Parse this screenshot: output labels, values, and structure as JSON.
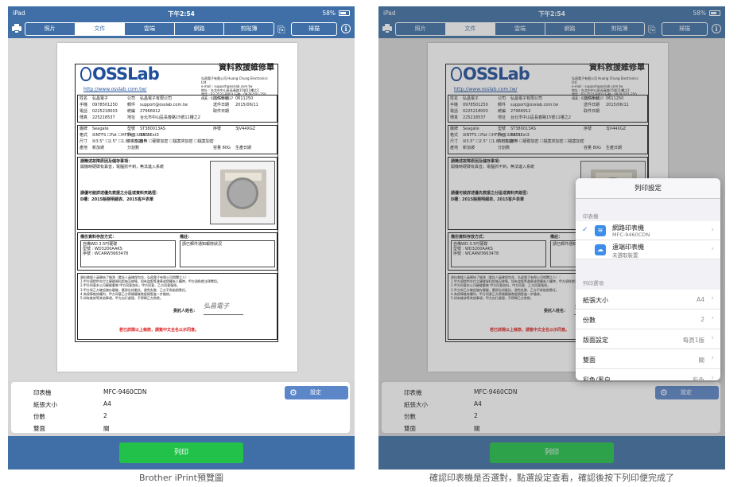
{
  "status": {
    "carrier": "iPad",
    "time": "下午2:54",
    "battery": "58%"
  },
  "toolbar": {
    "tabs": [
      "照片",
      "文件",
      "雲端",
      "網路",
      "剪貼簿"
    ],
    "active_tab": "文件",
    "edit_label": "掃描"
  },
  "form": {
    "logo": "OSSLab",
    "url": "http://www.osslab.com.tw/",
    "title": "資料救援維修單",
    "company": [
      "弘昌電子有限公司 Huang Chung Electronics Ltd.",
      "e-mail : support@osslab.com.tw",
      "地址 : 台北市中山區長春路15號11樓之2",
      "電話 : 02-2521-8003   行動 : 0978-501-250",
      "傳真 : 02-2521-8537"
    ],
    "rows1": [
      [
        "姓名",
        "弘昌電子",
        "公司",
        "弘昌電子有限公司",
        "送件單號",
        "0611250"
      ],
      [
        "手機",
        "0978501250",
        "郵件",
        "support@osslab.com.tw",
        "送件日期",
        "2015/06/11"
      ],
      [
        "電話",
        "0225218003",
        "統編",
        "27966912",
        "取件日期",
        ""
      ],
      [
        "傳真",
        "225218537",
        "地址",
        "台北市中山區長春路15號11樓之2",
        "",
        ""
      ]
    ],
    "rows2": [
      [
        "廠牌",
        "Seagate",
        "型號",
        "ST380013AS",
        "序號",
        "3JV44XGZ"
      ],
      [
        "格式",
        "☒NTFS ☐Fat ☐HFS+ ☐UFS ☐Ext3",
        "界面",
        "SATA",
        "",
        ""
      ],
      [
        "尺寸",
        "☒3.5\" ☐2.5\" ☐1.8\" ☐5.25\"",
        "資料加密",
        "☒無 ☐硬碟加密 ☐檔案夾加密 ☐檔案加密",
        "",
        ""
      ],
      [
        "產地",
        "新加坡",
        "分割數",
        "",
        "容量 80G",
        "生產日期"
      ]
    ],
    "issue_label": "請簡述故障原因及儲存事項：",
    "issue_text": "開機時硬碟有異音，電腦抓不到，無法進入系統",
    "path_label": "請優可敍詳述優先救援之分區或資料夾路徑：",
    "path_text": "D槽：2015賬務明細表、2015客戶表單",
    "backup_label": "備份資料存放方式：",
    "backup_lines": [
      "自備WD 3.5吋硬碟",
      "型號 : WD3200AAKS",
      "序號 : WCARW3663478"
    ],
    "note_label": "備註：",
    "note_text": "請已郵件通知報修狀況",
    "terms": [
      "資料救援人員開始了檢測（委託人員確保包含，弘昌電子有限公司相關之人）：",
      "1.甲方須提供交付之硬碟資料設施沒故障，如有盜版等違章或侵權有人權時，甲方須負擔法律費用。",
      "2.甲方同意本公司硬碟重做 甲方同意加料，甲方同意、乙方同意復原。",
      "3.甲方與乙方確認儲存硬碟，應即告知委託，避免失敗、乙方不負賠償責任。",
      "4.為保障維修權利，甲方同意乙方將開硬碟救援損害進一步檢修。",
      "5.如有維修等其他事項，甲方自行處理，不得歸乙方負擔。"
    ],
    "footer_warn": "若已詳閱以上條款，請簽中文全名以示同意。",
    "signer_label": "委託人姓名：",
    "signature": "弘昌電子"
  },
  "settings": {
    "rows": [
      {
        "label": "印表機",
        "value": "MFC-9460CDN"
      },
      {
        "label": "紙張大小",
        "value": "A4"
      },
      {
        "label": "份數",
        "value": "2"
      },
      {
        "label": "雙面",
        "value": "關"
      }
    ],
    "button": "設定",
    "print": "列印"
  },
  "popover": {
    "title": "列印設定",
    "printers_header": "印表機",
    "printers": [
      {
        "name": "網路印表機",
        "sub": "MFC-9460CDN",
        "icon": "wifi-icon",
        "selected": true
      },
      {
        "name": "遠端印表機",
        "sub": "未選取裝置",
        "icon": "cloud-icon",
        "selected": false
      }
    ],
    "options_header": "列印選項",
    "options": [
      {
        "label": "紙張大小",
        "value": "A4"
      },
      {
        "label": "份數",
        "value": "2"
      },
      {
        "label": "版面設定",
        "value": "每頁1版"
      },
      {
        "label": "雙面",
        "value": "關"
      },
      {
        "label": "彩色/黑白",
        "value": "彩色"
      }
    ]
  },
  "captions": {
    "left": "Brother iPrint預覽圖",
    "right": "確認印表機是否選對，點選設定查看，確認後按下列印便完成了"
  },
  "colors": {
    "bar": "#3f6fa6",
    "print": "#22c24a",
    "accent": "#2f7ce9"
  }
}
